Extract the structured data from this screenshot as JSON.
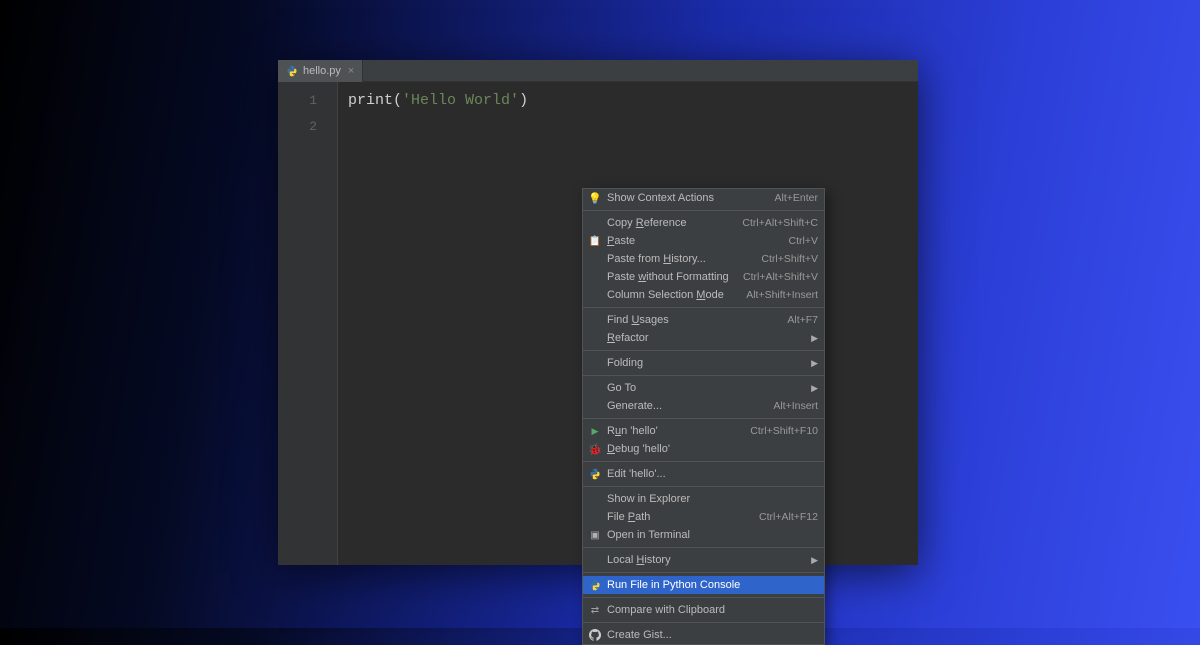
{
  "tab": {
    "filename": "hello.py"
  },
  "gutter": {
    "l1": "1",
    "l2": "2"
  },
  "code": {
    "func": "print",
    "open": "(",
    "str": "'Hello World'",
    "close": ")"
  },
  "menu": {
    "items": [
      {
        "icon": "bulb",
        "label": "Show Context Actions",
        "shortcut": "Alt+Enter"
      },
      {
        "sep": true
      },
      {
        "label": "Copy Reference",
        "u": "R",
        "shortcut": "Ctrl+Alt+Shift+C"
      },
      {
        "icon": "paste",
        "label": "Paste",
        "u": "P",
        "shortcut": "Ctrl+V"
      },
      {
        "label": "Paste from History...",
        "u": "H",
        "shortcut": "Ctrl+Shift+V"
      },
      {
        "label": "Paste without Formatting",
        "u": "w",
        "shortcut": "Ctrl+Alt+Shift+V"
      },
      {
        "label": "Column Selection Mode",
        "u": "M",
        "shortcut": "Alt+Shift+Insert"
      },
      {
        "sep": true
      },
      {
        "label": "Find Usages",
        "u": "U",
        "shortcut": "Alt+F7"
      },
      {
        "label": "Refactor",
        "u": "R",
        "submenu": true
      },
      {
        "sep": true
      },
      {
        "label": "Folding",
        "submenu": true
      },
      {
        "sep": true
      },
      {
        "label": "Go To",
        "submenu": true
      },
      {
        "label": "Generate...",
        "shortcut": "Alt+Insert"
      },
      {
        "sep": true
      },
      {
        "icon": "run",
        "label": "Run 'hello'",
        "u": "u",
        "shortcut": "Ctrl+Shift+F10"
      },
      {
        "icon": "debug",
        "label": "Debug 'hello'",
        "u": "D"
      },
      {
        "sep": true
      },
      {
        "icon": "python",
        "label": "Edit 'hello'..."
      },
      {
        "sep": true
      },
      {
        "label": "Show in Explorer"
      },
      {
        "label": "File Path",
        "u": "P",
        "shortcut": "Ctrl+Alt+F12"
      },
      {
        "icon": "term",
        "label": "Open in Terminal"
      },
      {
        "sep": true
      },
      {
        "label": "Local History",
        "u": "H",
        "submenu": true
      },
      {
        "sep": true
      },
      {
        "icon": "python",
        "label": "Run File in Python Console",
        "highlight": true
      },
      {
        "sep": true
      },
      {
        "icon": "compare",
        "label": "Compare with Clipboard"
      },
      {
        "sep": true
      },
      {
        "icon": "github",
        "label": "Create Gist..."
      }
    ]
  }
}
